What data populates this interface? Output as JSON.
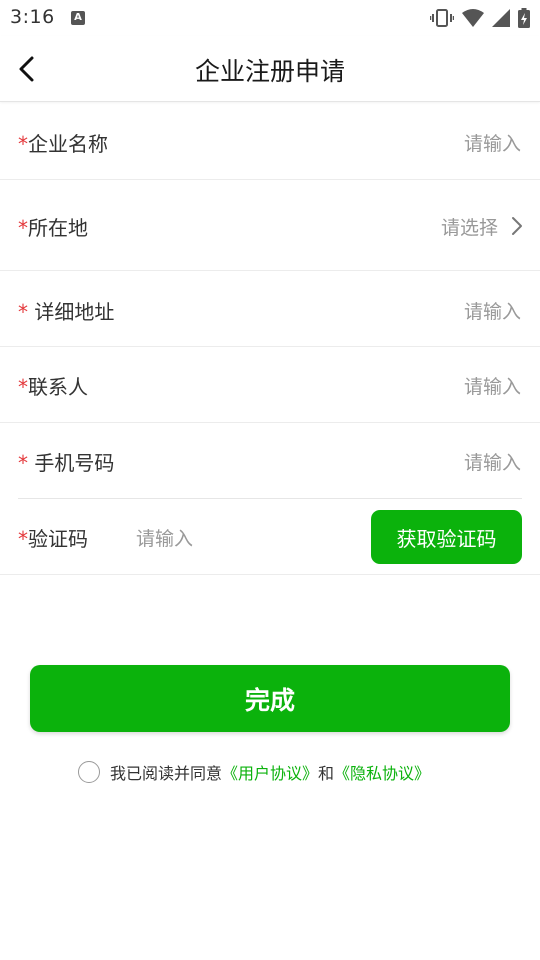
{
  "status_bar": {
    "time": "3:16",
    "notification_icon": "A",
    "icons": [
      "vibrate-icon",
      "wifi-icon",
      "signal-icon",
      "battery-charging-icon"
    ]
  },
  "header": {
    "title": "企业注册申请",
    "back_icon": "chevron-left-icon"
  },
  "form": {
    "company_name": {
      "star": "*",
      "label": "企业名称",
      "placeholder": "请输入"
    },
    "location": {
      "star": "*",
      "label": "所在地",
      "placeholder": "请选择",
      "icon": "chevron-right-icon"
    },
    "address": {
      "star": "*",
      "label": " 详细地址",
      "placeholder": "请输入"
    },
    "contact": {
      "star": "*",
      "label": "联系人",
      "placeholder": "请输入"
    },
    "phone": {
      "star": "*",
      "label": " 手机号码",
      "placeholder": "请输入"
    },
    "code": {
      "star": "*",
      "label": "验证码",
      "placeholder": "请输入",
      "button_label": "获取验证码"
    }
  },
  "submit": {
    "label": "完成"
  },
  "agreement": {
    "prefix": "我已阅读并同意",
    "user_agreement": "《用户协议》",
    "conjunction": "和",
    "privacy_agreement": "《隐私协议》"
  },
  "colors": {
    "accent": "#0bb20c",
    "required": "#e4393c",
    "placeholder": "#999999"
  }
}
